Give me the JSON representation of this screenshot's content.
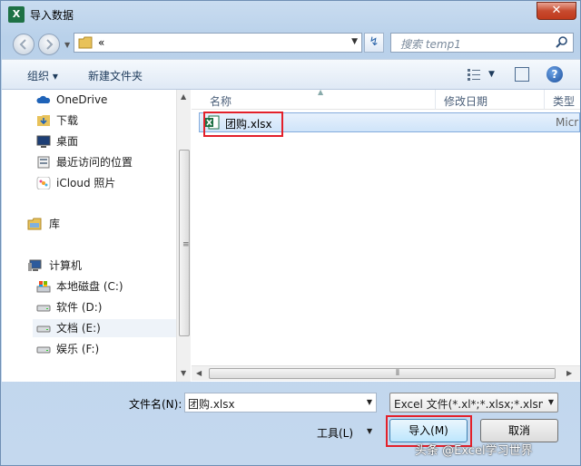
{
  "window": {
    "title": "导入数据",
    "close_label": "✕",
    "app_icon_letter": "X"
  },
  "address": {
    "path": "«",
    "refresh": "↯"
  },
  "search": {
    "placeholder": "搜索 temp1"
  },
  "toolbar": {
    "organize": "组织 ▾",
    "new_folder": "新建文件夹"
  },
  "nav": {
    "favorites": [
      {
        "label": "OneDrive",
        "icon": "onedrive-icon"
      },
      {
        "label": "下载",
        "icon": "download-folder-icon"
      },
      {
        "label": "桌面",
        "icon": "desktop-icon"
      },
      {
        "label": "最近访问的位置",
        "icon": "recent-places-icon"
      },
      {
        "label": "iCloud 照片",
        "icon": "icloud-photos-icon"
      }
    ],
    "library": {
      "label": "库",
      "icon": "library-icon"
    },
    "computer": {
      "label": "计算机",
      "icon": "computer-icon"
    },
    "drives": [
      {
        "label": "本地磁盘 (C:)",
        "icon": "system-drive-icon"
      },
      {
        "label": "软件 (D:)",
        "icon": "drive-icon"
      },
      {
        "label": "文档 (E:)",
        "icon": "drive-icon",
        "selected": true
      },
      {
        "label": "娱乐 (F:)",
        "icon": "drive-icon"
      }
    ]
  },
  "columns": {
    "name": "名称",
    "modified": "修改日期",
    "type": "类型"
  },
  "files": [
    {
      "name": "团购.xlsx",
      "type": "Micr",
      "icon": "excel-file-icon"
    }
  ],
  "bottom": {
    "filename_label": "文件名(N):",
    "filename_value": "团购.xlsx",
    "filetype_value": "Excel 文件(*.xl*;*.xlsx;*.xlsm;*.",
    "tools": "工具(L)",
    "import_button": "导入(M)",
    "cancel_button": "取消"
  },
  "watermark": "头条 @Excel学习世界",
  "colors": {
    "highlight": "#e3202a",
    "selection": "#cfe4fa",
    "chrome": "#b9d1ea"
  }
}
